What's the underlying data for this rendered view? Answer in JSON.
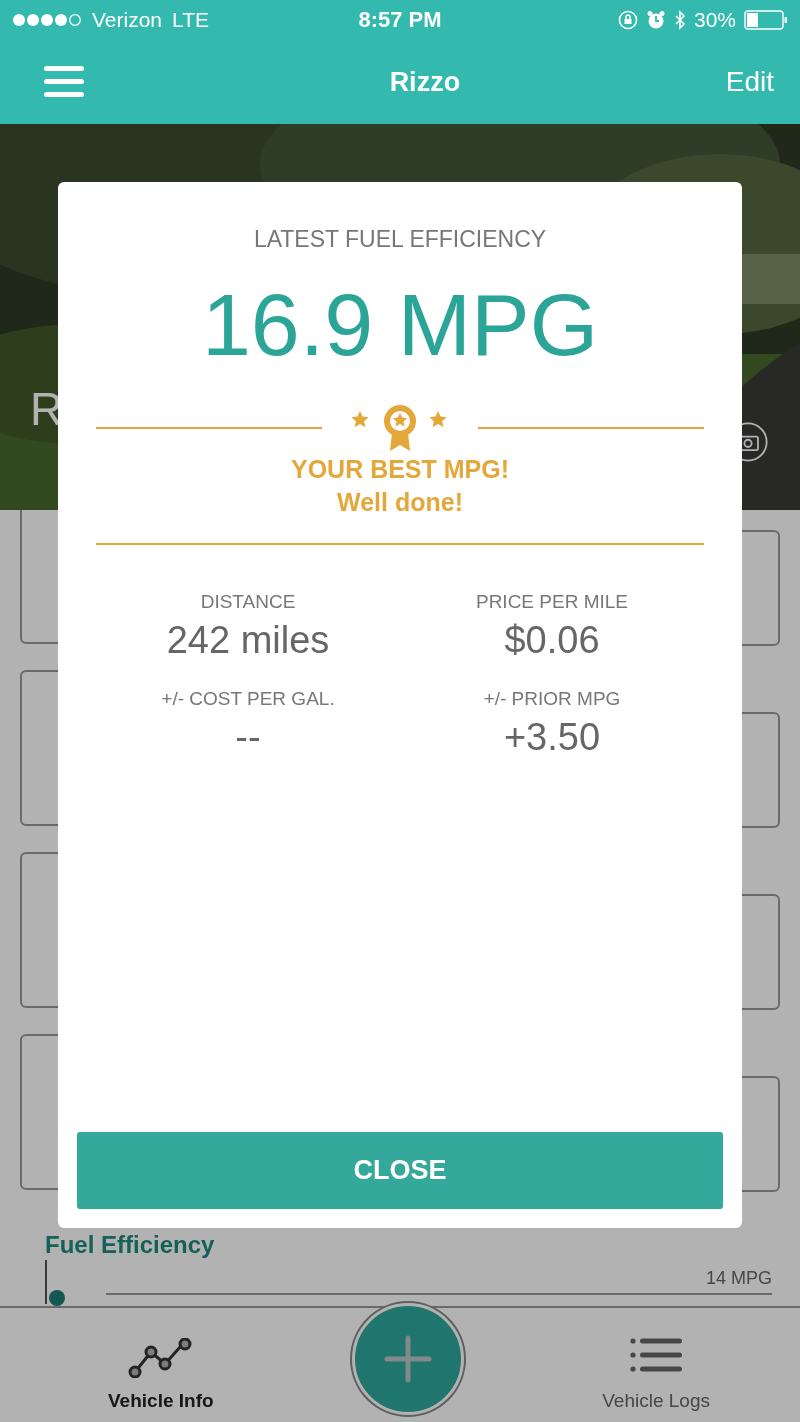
{
  "status_bar": {
    "carrier": "Verizon",
    "network": "LTE",
    "time": "8:57 PM",
    "battery": "30%"
  },
  "header": {
    "title": "Rizzo",
    "action": "Edit"
  },
  "background": {
    "vehicle_name": "R",
    "chart_title": "Fuel Efficiency",
    "chart_label": "14 MPG"
  },
  "modal": {
    "heading": "LATEST FUEL EFFICIENCY",
    "value": "16.9 MPG",
    "badge": {
      "title": "YOUR BEST MPG!",
      "subtitle": "Well done!"
    },
    "stats": [
      {
        "label": "DISTANCE",
        "value": "242 miles"
      },
      {
        "label": "PRICE PER MILE",
        "value": "$0.06"
      },
      {
        "label": "+/- COST PER GAL.",
        "value": "--"
      },
      {
        "label": "+/- PRIOR MPG",
        "value": "+3.50"
      }
    ],
    "button": "CLOSE"
  },
  "tabs": [
    {
      "label": "Vehicle Info",
      "kind": "chart",
      "selected": true
    },
    {
      "label": "Vehicle Logs",
      "kind": "list",
      "selected": false
    }
  ]
}
